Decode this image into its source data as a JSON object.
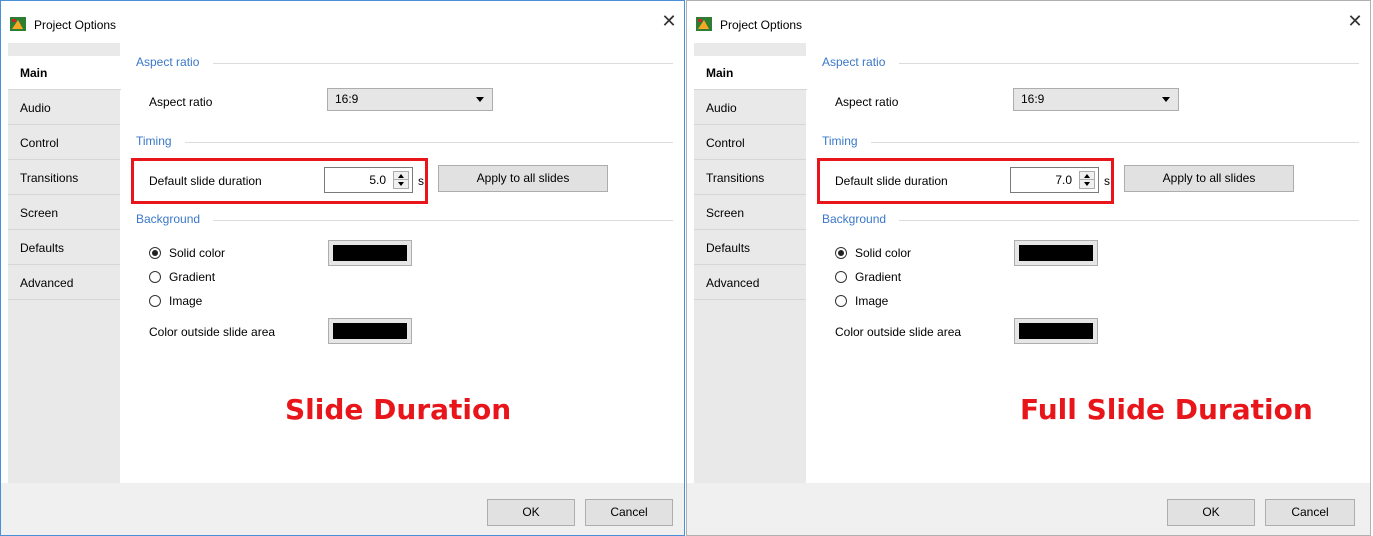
{
  "dialogs": [
    {
      "title": "Project Options",
      "tabs": [
        "Main",
        "Audio",
        "Control",
        "Transitions",
        "Screen",
        "Defaults",
        "Advanced"
      ],
      "active_tab": "Main",
      "aspect_section": "Aspect ratio",
      "aspect_label": "Aspect ratio",
      "aspect_value": "16:9",
      "timing_section": "Timing",
      "duration_label": "Default slide duration",
      "duration_value": "5.0",
      "duration_unit": "s",
      "apply_button": "Apply to all slides",
      "background_section": "Background",
      "radio_solid": "Solid color",
      "radio_gradient": "Gradient",
      "radio_image": "Image",
      "selected_background": "Solid color",
      "outside_label": "Color outside slide area",
      "swatch_color": "#000000",
      "caption": "Slide Duration",
      "ok": "OK",
      "cancel": "Cancel"
    },
    {
      "title": "Project Options",
      "tabs": [
        "Main",
        "Audio",
        "Control",
        "Transitions",
        "Screen",
        "Defaults",
        "Advanced"
      ],
      "active_tab": "Main",
      "aspect_section": "Aspect ratio",
      "aspect_label": "Aspect ratio",
      "aspect_value": "16:9",
      "timing_section": "Timing",
      "duration_label": "Default slide duration",
      "duration_value": "7.0",
      "duration_unit": "s",
      "apply_button": "Apply to all slides",
      "background_section": "Background",
      "radio_solid": "Solid color",
      "radio_gradient": "Gradient",
      "radio_image": "Image",
      "selected_background": "Solid color",
      "outside_label": "Color outside slide area",
      "swatch_color": "#000000",
      "caption": "Full Slide Duration",
      "ok": "OK",
      "cancel": "Cancel"
    }
  ],
  "colors": {
    "accent_blue": "#3a78c8",
    "highlight_red": "#e8161a",
    "active_border": "#4a90d9"
  },
  "icons": {
    "app": "project-options-app-icon",
    "close": "close-icon"
  }
}
